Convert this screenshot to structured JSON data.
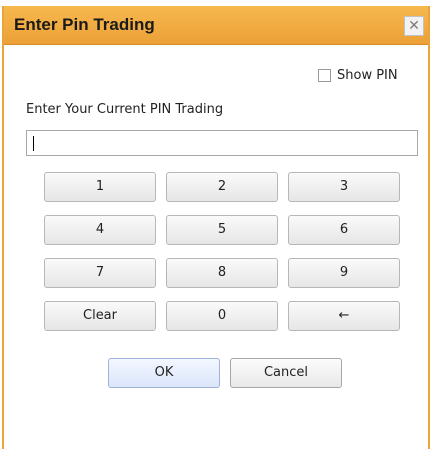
{
  "window": {
    "title": "Enter Pin Trading",
    "close_glyph": "✕",
    "close_icon": "close-icon",
    "accent_color": "#eba137"
  },
  "show_pin": {
    "label": "Show PIN",
    "checked": false
  },
  "prompt": "Enter Your Current PIN Trading",
  "pin_input": {
    "value": ""
  },
  "keypad": {
    "k1": "1",
    "k2": "2",
    "k3": "3",
    "k4": "4",
    "k5": "5",
    "k6": "6",
    "k7": "7",
    "k8": "8",
    "k9": "9",
    "clear": "Clear",
    "k0": "0",
    "backspace": "←"
  },
  "buttons": {
    "ok": "OK",
    "cancel": "Cancel"
  }
}
